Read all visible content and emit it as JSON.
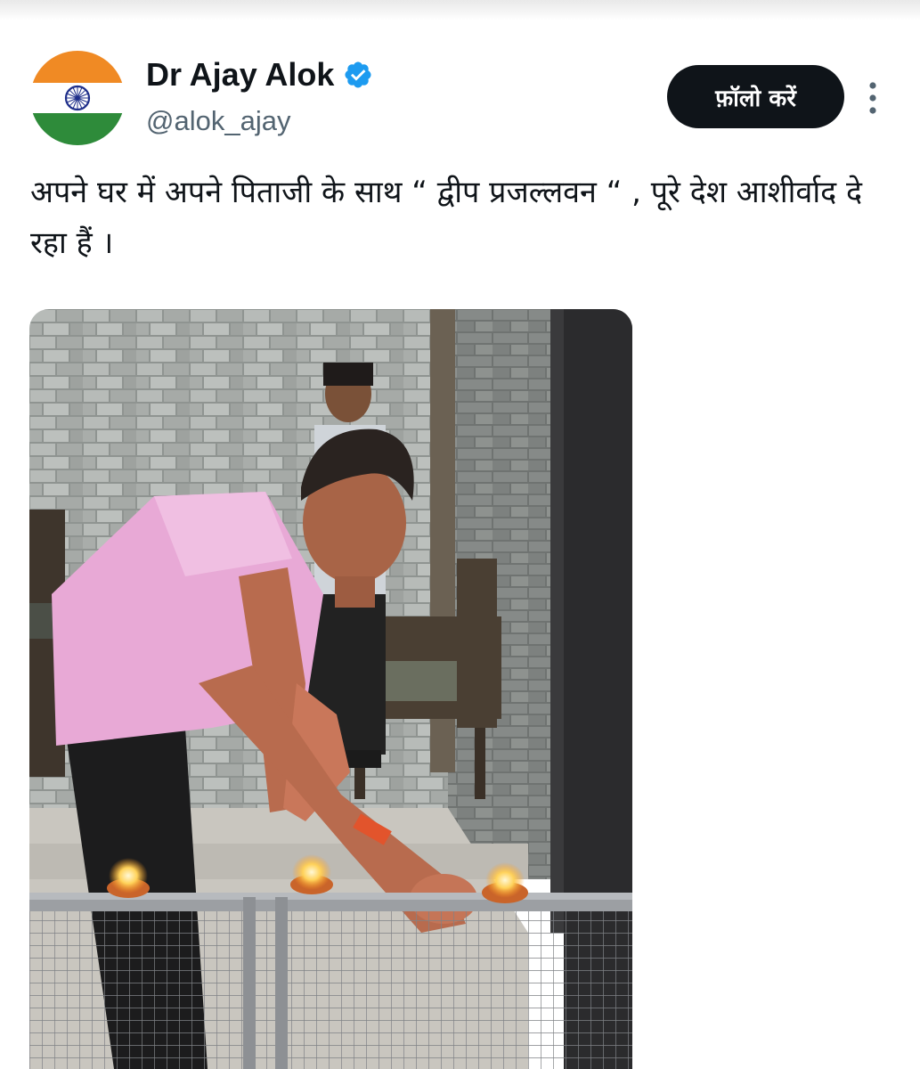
{
  "author": {
    "display_name": "Dr Ajay Alok",
    "handle": "@alok_ajay",
    "verified": true,
    "avatar_icon": "india-flag-icon",
    "verified_icon": "verified-badge-icon",
    "verified_color": "#1d9bf0"
  },
  "actions": {
    "follow_label": "फ़ॉलो करें",
    "more_icon": "more-vertical-icon"
  },
  "tweet": {
    "text": "अपने घर में अपने पिताजी के साथ “ द्वीप प्रजल्लवन “ , पूरे देश आशीर्वाद दे रहा हैं ।"
  },
  "colors": {
    "text_primary": "#0f1419",
    "text_secondary": "#536471",
    "button_bg": "#0f1419",
    "button_text": "#ffffff"
  }
}
